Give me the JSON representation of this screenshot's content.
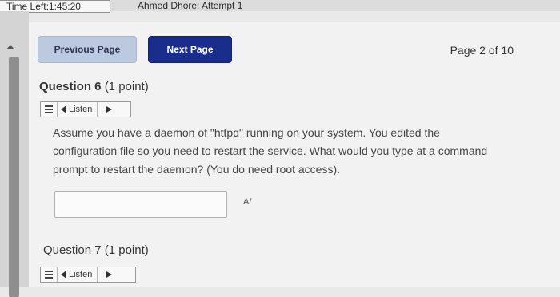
{
  "status": {
    "time_left": "Time Left:1:45:20",
    "attempt": "Ahmed Dhore: Attempt 1"
  },
  "nav": {
    "previous_label": "Previous Page",
    "next_label": "Next Page",
    "page_indicator": "Page 2 of 10"
  },
  "questions": [
    {
      "title": "Question 6",
      "points": "(1 point)",
      "listen_label": "Listen",
      "text": "Assume you have a daemon of \"httpd\" running on your system. You edited the configuration file so you need to restart the service. What would you type at a command prompt to restart the daemon? (You do need root access).",
      "answer_value": "",
      "spellcheck_glyph": "A/"
    },
    {
      "title": "Question 7",
      "points": "(1 point)",
      "listen_label": "Listen"
    }
  ],
  "icons": [
    "menu-icon",
    "speaker-icon",
    "play-icon",
    "spellcheck-icon",
    "scroll-up-icon"
  ],
  "colors": {
    "next_button": "#1a2d8c",
    "previous_button": "#bcc9df",
    "panel_bg": "#f2f2f2"
  }
}
